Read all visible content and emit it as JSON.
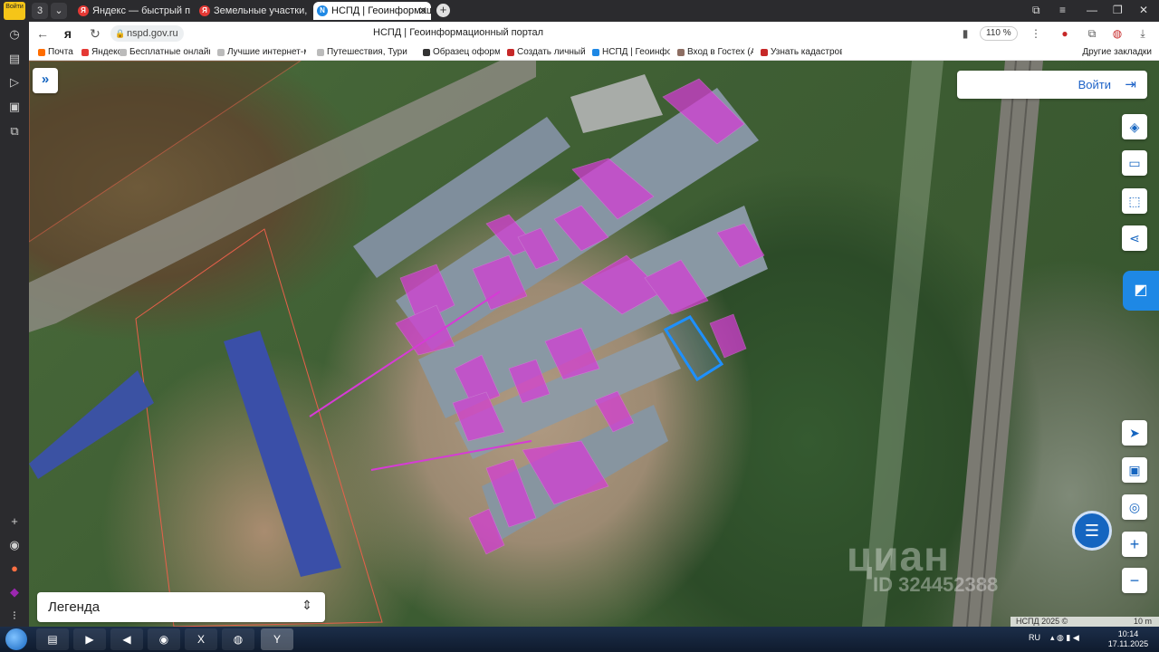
{
  "browser": {
    "profile_badge": "Войти",
    "tab_count_badge": "3",
    "tabs": [
      {
        "title": "Яндекс — быстрый поиск",
        "fav": "Я"
      },
      {
        "title": "Земельные участки, своб",
        "fav": "Я"
      },
      {
        "title": "НСПД | Геоинформаци",
        "fav": "N",
        "active": true
      }
    ],
    "url": "nspd.gov.ru",
    "page_title": "НСПД | Геоинформационный портал",
    "zoom": "110 %",
    "bookmarks": [
      {
        "label": "Почта",
        "color": "#ff6d00"
      },
      {
        "label": "Яндекс",
        "color": "#e53935"
      },
      {
        "label": "Бесплатные онлайн",
        "color": "#ffffff"
      },
      {
        "label": "Лучшие интернет-м",
        "color": "#ffffff"
      },
      {
        "label": "Путешествия, Туриз",
        "color": "#ffffff"
      },
      {
        "label": "Образец оформл",
        "color": "#333333"
      },
      {
        "label": "Создать личный",
        "color": "#c62828"
      },
      {
        "label": "НСПД | Геоинфор",
        "color": "#1e88e5"
      },
      {
        "label": "Вход в Гостех (Ау",
        "color": "#8d6e63"
      },
      {
        "label": "Узнать кадастров",
        "color": "#c62828"
      }
    ],
    "other_bookmarks": "Другие закладки"
  },
  "map": {
    "login_label": "Войти",
    "legend_label": "Легенда",
    "watermark": "циан",
    "watermark_id": "ID 324452388",
    "attribution": "НСПД 2025 ©",
    "scale_label": "10 m",
    "tools": [
      "layers-icon",
      "ruler-icon",
      "select-area-icon",
      "share-icon",
      "print-icon",
      "navigate-icon",
      "minimap-icon",
      "locate-icon",
      "zoom-in-icon",
      "zoom-out-icon"
    ],
    "colors": {
      "parcel_fill": "#d63bd6",
      "parcel_border": "#e8604a",
      "selected": "#1e90ff"
    }
  },
  "taskbar": {
    "lang": "RU",
    "time": "10:14",
    "date": "17.11.2025"
  }
}
